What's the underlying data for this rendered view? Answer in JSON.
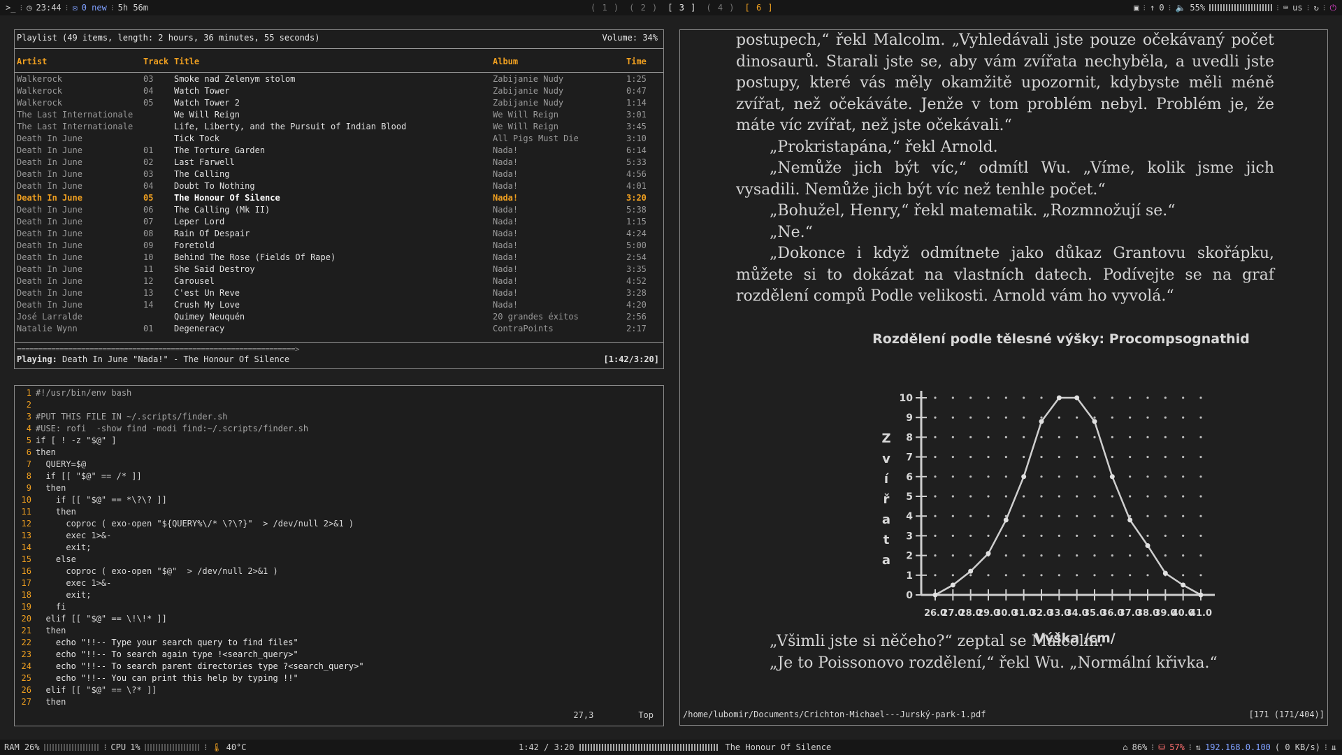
{
  "topbar": {
    "prompt": ">_",
    "clock": "23:44",
    "mail": "0 new",
    "uptime": "5h 56m",
    "workspaces": [
      "( 1 )",
      "( 2 )",
      "[ 3 ]",
      "( 4 )",
      "[ 6 ]"
    ],
    "updates": "0",
    "volume": "55%",
    "keyboard": "us"
  },
  "cmus": {
    "header": "Playlist (49 items, length: 2 hours, 36 minutes, 55 seconds)",
    "volume": "Volume: 34%",
    "columns": {
      "artist": "Artist",
      "track": "Track",
      "title": "Title",
      "album": "Album",
      "time": "Time"
    },
    "rows": [
      {
        "artist": "Walkerock",
        "track": "03",
        "title": "Smoke nad Zelenym stolom",
        "album": "Zabijanie Nudy",
        "time": "1:25"
      },
      {
        "artist": "Walkerock",
        "track": "04",
        "title": "Watch Tower",
        "album": "Zabijanie Nudy",
        "time": "0:47"
      },
      {
        "artist": "Walkerock",
        "track": "05",
        "title": "Watch Tower 2",
        "album": "Zabijanie Nudy",
        "time": "1:14"
      },
      {
        "artist": "The Last Internationale",
        "track": "",
        "title": "We Will Reign",
        "album": "We Will Reign",
        "time": "3:01"
      },
      {
        "artist": "The Last Internationale",
        "track": "",
        "title": "Life, Liberty, and the Pursuit of Indian Blood",
        "album": "We Will Reign",
        "time": "3:45"
      },
      {
        "artist": "Death In June",
        "track": "",
        "title": "Tick Tock",
        "album": "All Pigs Must Die",
        "time": "3:10"
      },
      {
        "artist": "Death In June",
        "track": "01",
        "title": "The Torture Garden",
        "album": "Nada!",
        "time": "6:14"
      },
      {
        "artist": "Death In June",
        "track": "02",
        "title": "Last Farwell",
        "album": "Nada!",
        "time": "5:33"
      },
      {
        "artist": "Death In June",
        "track": "03",
        "title": "The Calling",
        "album": "Nada!",
        "time": "4:56"
      },
      {
        "artist": "Death In June",
        "track": "04",
        "title": "Doubt To Nothing",
        "album": "Nada!",
        "time": "4:01"
      },
      {
        "artist": "Death In June",
        "track": "05",
        "title": "The Honour Of Silence",
        "album": "Nada!",
        "time": "3:20",
        "current": true
      },
      {
        "artist": "Death In June",
        "track": "06",
        "title": "The Calling (Mk II)",
        "album": "Nada!",
        "time": "5:38"
      },
      {
        "artist": "Death In June",
        "track": "07",
        "title": "Leper Lord",
        "album": "Nada!",
        "time": "1:15"
      },
      {
        "artist": "Death In June",
        "track": "08",
        "title": "Rain Of Despair",
        "album": "Nada!",
        "time": "4:24"
      },
      {
        "artist": "Death In June",
        "track": "09",
        "title": "Foretold",
        "album": "Nada!",
        "time": "5:00"
      },
      {
        "artist": "Death In June",
        "track": "10",
        "title": "Behind The Rose (Fields Of Rape)",
        "album": "Nada!",
        "time": "2:54"
      },
      {
        "artist": "Death In June",
        "track": "11",
        "title": "She Said Destroy",
        "album": "Nada!",
        "time": "3:35"
      },
      {
        "artist": "Death In June",
        "track": "12",
        "title": "Carousel",
        "album": "Nada!",
        "time": "4:52"
      },
      {
        "artist": "Death In June",
        "track": "13",
        "title": "C'est Un Reve",
        "album": "Nada!",
        "time": "3:28"
      },
      {
        "artist": "Death In June",
        "track": "14",
        "title": "Crush My Love",
        "album": "Nada!",
        "time": "4:20"
      },
      {
        "artist": "José Larralde",
        "track": "",
        "title": "Quimey Neuquén",
        "album": "20 grandes éxitos",
        "time": "2:56"
      },
      {
        "artist": "Natalie Wynn",
        "track": "01",
        "title": "Degeneracy",
        "album": "ContraPoints",
        "time": "2:17"
      }
    ],
    "progress_bar": "=================================================================>",
    "status_label": "Playing:",
    "status_text": " Death In June \"Nada!\" - The Honour Of Silence",
    "position": "[1:42/3:20]"
  },
  "vim": {
    "lines": [
      {
        "n": "1",
        "text": "#!/usr/bin/env bash"
      },
      {
        "n": "2",
        "text": ""
      },
      {
        "n": "3",
        "text": "#PUT THIS FILE IN ~/.scripts/finder.sh"
      },
      {
        "n": "4",
        "text": "#USE: rofi  -show find -modi find:~/.scripts/finder.sh"
      },
      {
        "n": "5",
        "text": "if [ ! -z \"$@\" ]"
      },
      {
        "n": "6",
        "text": "then"
      },
      {
        "n": "7",
        "text": "  QUERY=$@"
      },
      {
        "n": "8",
        "text": "  if [[ \"$@\" == /* ]]"
      },
      {
        "n": "9",
        "text": "  then"
      },
      {
        "n": "10",
        "text": "    if [[ \"$@\" == *\\?\\? ]]"
      },
      {
        "n": "11",
        "text": "    then"
      },
      {
        "n": "12",
        "text": "      coproc ( exo-open \"${QUERY%\\/* \\?\\?}\"  > /dev/null 2>&1 )"
      },
      {
        "n": "13",
        "text": "      exec 1>&-"
      },
      {
        "n": "14",
        "text": "      exit;"
      },
      {
        "n": "15",
        "text": "    else"
      },
      {
        "n": "16",
        "text": "      coproc ( exo-open \"$@\"  > /dev/null 2>&1 )"
      },
      {
        "n": "17",
        "text": "      exec 1>&-"
      },
      {
        "n": "18",
        "text": "      exit;"
      },
      {
        "n": "19",
        "text": "    fi"
      },
      {
        "n": "20",
        "text": "  elif [[ \"$@\" == \\!\\!* ]]"
      },
      {
        "n": "21",
        "text": "  then"
      },
      {
        "n": "22",
        "text": "    echo \"!!-- Type your search query to find files\""
      },
      {
        "n": "23",
        "text": "    echo \"!!-- To search again type !<search_query>\""
      },
      {
        "n": "24",
        "text": "    echo \"!!-- To search parent directories type ?<search_query>\""
      },
      {
        "n": "25",
        "text": "    echo \"!!-- You can print this help by typing !!\""
      },
      {
        "n": "26",
        "text": "  elif [[ \"$@\" == \\?* ]]"
      },
      {
        "n": "27",
        "text": "  then"
      }
    ],
    "cursor_pos": "27,3",
    "scroll_pos": "Top"
  },
  "pdf": {
    "paragraphs": [
      {
        "indent": false,
        "text": "postupech,“ řekl Malcolm. „Vyhledávali jste pouze očekávaný počet dinosaurů. Starali jste se, aby vám zvířata nechyběla, a uvedli jste postupy, které vás měly okamžitě upozornit, kdybyste měli méně zvířat, než očekáváte. Jenže v tom problém nebyl. Problém je, že máte víc zvířat, než jste očekávali.“"
      },
      {
        "indent": true,
        "text": "„Prokristapána,“ řekl Arnold."
      },
      {
        "indent": true,
        "text": "„Nemůže jich být víc,“ odmítl Wu. „Víme, kolik jsme jich vysadili. Nemůže jich být víc než tenhle počet.“"
      },
      {
        "indent": true,
        "text": "„Bohužel, Henry,“ řekl matematik. „Rozmnožují se.“"
      },
      {
        "indent": true,
        "text": "„Ne.“"
      },
      {
        "indent": true,
        "text": "„Dokonce i když odmítnete jako důkaz Grantovu skořápku, můžete si to dokázat na vlastních datech. Podívejte se na graf rozdělení compů Podle velikosti. Arnold vám ho vyvolá.“"
      }
    ],
    "after": [
      "„Všimli jste si něčeho?“ zeptal se Malcolm.",
      "„Je to Poissonovo rozdělení,“ řekl Wu. „Normální křivka.“"
    ],
    "path": "/home/lubomir/Documents/Crichton-Michael---Jurský-park-1.pdf",
    "page": "[171 (171/404)]"
  },
  "chart_data": {
    "type": "line",
    "title": "Rozdělení podle tělesné výšky: Procompsognathid",
    "xlabel": "Výška /cm/",
    "ylabel": "Zvířata",
    "ylabel_letters": [
      "Z",
      "v",
      "í",
      "ř",
      "a",
      "t",
      "a"
    ],
    "x": [
      26.0,
      27.0,
      28.0,
      29.0,
      30.0,
      31.0,
      32.0,
      33.0,
      34.0,
      35.0,
      36.0,
      37.0,
      38.0,
      39.0,
      40.0,
      41.0
    ],
    "x_tick_labels": [
      "26.0",
      "27.0",
      "28.0",
      "29.0",
      "30.0",
      "31.0",
      "32.0",
      "33.0",
      "34.0",
      "35.0",
      "36.0",
      "37.0",
      "38.0",
      "39.0",
      "40.0",
      "41.0"
    ],
    "y": [
      0,
      0.5,
      1.2,
      2.1,
      3.8,
      6.0,
      8.8,
      10,
      10,
      8.8,
      6.0,
      3.8,
      2.5,
      1.1,
      0.5,
      0
    ],
    "y_ticks": [
      0,
      1,
      2,
      3,
      4,
      5,
      6,
      7,
      8,
      9,
      10
    ],
    "xlim": [
      26,
      41
    ],
    "ylim": [
      0,
      10
    ],
    "grid": "dotted"
  },
  "botbar": {
    "ram": "RAM 26%",
    "cpu": "CPU",
    "cpu_val": "1%",
    "temp": "40°C",
    "playtime": "1:42 / 3:20",
    "track": "The Honour Of Silence",
    "battery": "86%",
    "disk": "57%",
    "ip": "192.168.0.100",
    "net": "( 0 KB/s)"
  }
}
